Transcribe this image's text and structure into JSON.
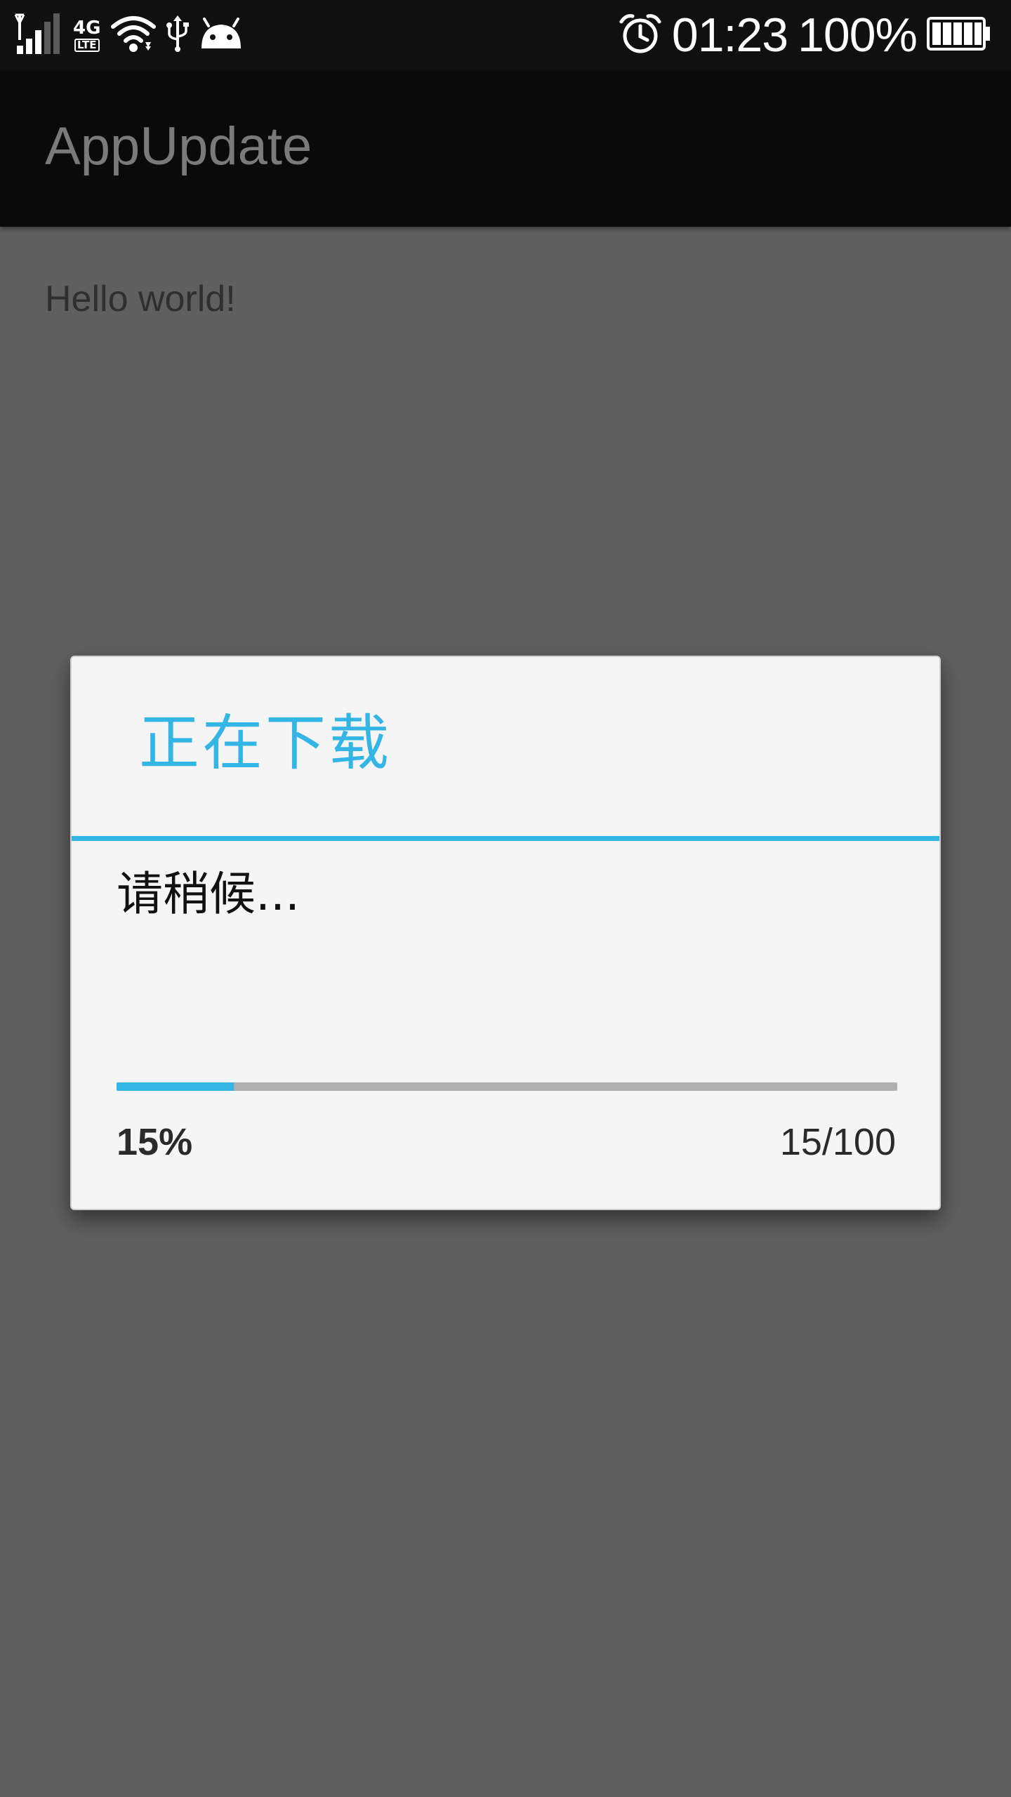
{
  "status_bar": {
    "network_type": "4G",
    "network_sub": "LTE",
    "time": "01:23",
    "battery_percent": "100%",
    "icons": [
      "signal-icon",
      "wifi-icon",
      "usb-icon",
      "android-debug-icon",
      "alarm-icon",
      "battery-icon"
    ]
  },
  "action_bar": {
    "title": "AppUpdate"
  },
  "content": {
    "text": "Hello world!"
  },
  "dialog": {
    "title": "正在下载",
    "message": "请稍候...",
    "progress": {
      "value": 15,
      "max": 100,
      "percent_label": "15%",
      "number_label": "15/100"
    }
  },
  "colors": {
    "accent": "#33b5e5",
    "status_bar_bg": "#101010",
    "action_bar_bg": "#0a0a0a",
    "dim_bg": "#5f5f5f",
    "dialog_bg": "#f5f5f5"
  }
}
